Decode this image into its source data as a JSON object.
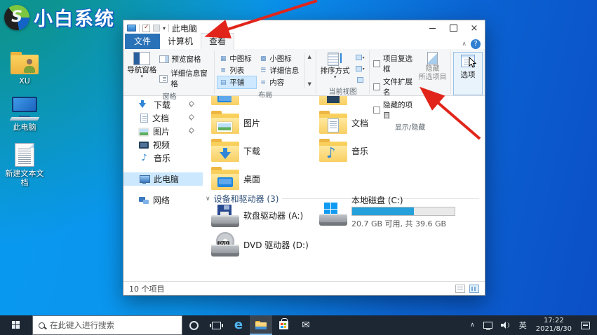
{
  "branding": {
    "logo_text": "小白系统"
  },
  "desktop_icons": [
    {
      "label": "XU"
    },
    {
      "label": "此电脑"
    },
    {
      "label": "新建文本文档"
    }
  ],
  "explorer": {
    "title": "此电脑",
    "tabs": {
      "file": "文件",
      "computer": "计算机",
      "view": "查看"
    },
    "ribbon": {
      "panes_group": {
        "nav_pane": "导航窗格",
        "preview_pane": "预览窗格",
        "details_pane": "详细信息窗格",
        "label": "窗格"
      },
      "layout_group": {
        "items": [
          "中图标",
          "小图标",
          "列表",
          "详细信息",
          "平铺",
          "内容"
        ],
        "selected": "平铺",
        "label": "布局"
      },
      "current_view_group": {
        "sort_by": "排序方式",
        "label": "当前视图"
      },
      "show_hide_group": {
        "checkboxes": [
          "项目复选框",
          "文件扩展名",
          "隐藏的项目"
        ],
        "hide_selected_line1": "隐藏",
        "hide_selected_line2": "所选项目",
        "label": "显示/隐藏"
      },
      "options_label": "选项"
    },
    "nav_pane": {
      "items": [
        {
          "label": "下载",
          "pinned": true
        },
        {
          "label": "文档",
          "pinned": true
        },
        {
          "label": "图片",
          "pinned": true
        },
        {
          "label": "视频",
          "pinned": false
        },
        {
          "label": "音乐",
          "pinned": false
        },
        {
          "label": "此电脑",
          "pinned": false,
          "selected": true
        },
        {
          "label": "网络",
          "pinned": false
        }
      ]
    },
    "content": {
      "folders": [
        {
          "label": "图片"
        },
        {
          "label": "文档"
        },
        {
          "label": "下载"
        },
        {
          "label": "音乐"
        },
        {
          "label": "桌面"
        }
      ],
      "devices_header": "设备和驱动器 (3)",
      "drives": [
        {
          "label": "软盘驱动器 (A:)"
        },
        {
          "label": "本地磁盘 (C:)",
          "capacity_text": "20.7 GB 可用, 共 39.6 GB",
          "used_percent": 60
        },
        {
          "label": "DVD 驱动器 (D:)",
          "badge": "DVD"
        }
      ]
    },
    "status_bar": {
      "item_count": "10 个项目"
    }
  },
  "taskbar": {
    "search_placeholder": "在此键入进行搜索",
    "edge_glyph": "e",
    "ime_indicator": "英",
    "time": "17:22",
    "date": "2021/8/30"
  },
  "colors": {
    "accent": "#0078d7",
    "selection": "#cce8ff",
    "desktop_teal": "#0d9492",
    "desktop_blue": "#0b4ec6",
    "arrow_red": "#e1251b",
    "taskbar": "#1c2733"
  }
}
